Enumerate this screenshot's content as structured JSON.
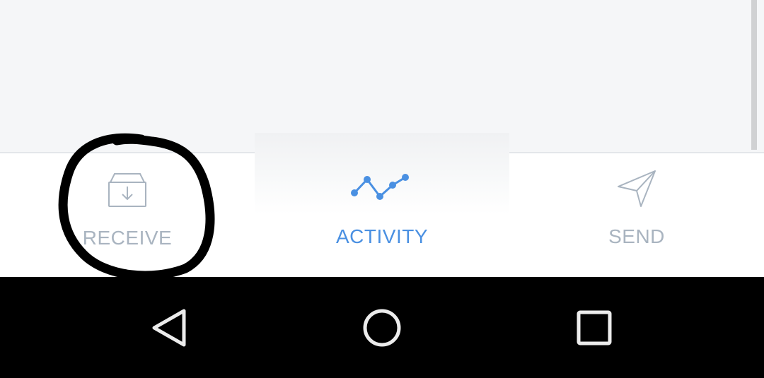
{
  "tabs": [
    {
      "label": "RECEIVE",
      "icon": "inbox-download-icon",
      "active": false,
      "color": "#a9b4c0"
    },
    {
      "label": "ACTIVITY",
      "icon": "activity-chart-icon",
      "active": true,
      "color": "#4a90e2"
    },
    {
      "label": "SEND",
      "icon": "paper-plane-icon",
      "active": false,
      "color": "#a9b4c0"
    }
  ],
  "nav": {
    "back_icon": "back-triangle-icon",
    "home_icon": "home-circle-icon",
    "recents_icon": "recents-square-icon"
  },
  "colors": {
    "accent": "#4a90e2",
    "inactive": "#a9b4c0",
    "content_bg": "#f5f6f8",
    "annotation": "#000000"
  }
}
